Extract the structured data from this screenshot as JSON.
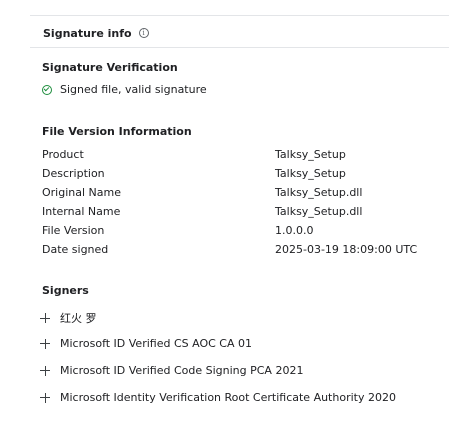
{
  "header": {
    "title": "Signature info",
    "info_glyph": "i"
  },
  "verification": {
    "title": "Signature Verification",
    "status": "Signed file, valid signature",
    "status_color": "#1e8e3e"
  },
  "file_version": {
    "title": "File Version Information",
    "rows": [
      {
        "key": "Product",
        "value": "Talksy_Setup"
      },
      {
        "key": "Description",
        "value": "Talksy_Setup"
      },
      {
        "key": "Original Name",
        "value": "Talksy_Setup.dll"
      },
      {
        "key": "Internal Name",
        "value": "Talksy_Setup.dll"
      },
      {
        "key": "File Version",
        "value": "1.0.0.0"
      },
      {
        "key": "Date signed",
        "value": "2025-03-19 18:09:00 UTC"
      }
    ]
  },
  "signers": {
    "title": "Signers",
    "items": [
      {
        "label": "红火 罗"
      },
      {
        "label": "Microsoft ID Verified CS AOC CA 01"
      },
      {
        "label": "Microsoft ID Verified Code Signing PCA 2021"
      },
      {
        "label": "Microsoft Identity Verification Root Certificate Authority 2020"
      }
    ]
  }
}
